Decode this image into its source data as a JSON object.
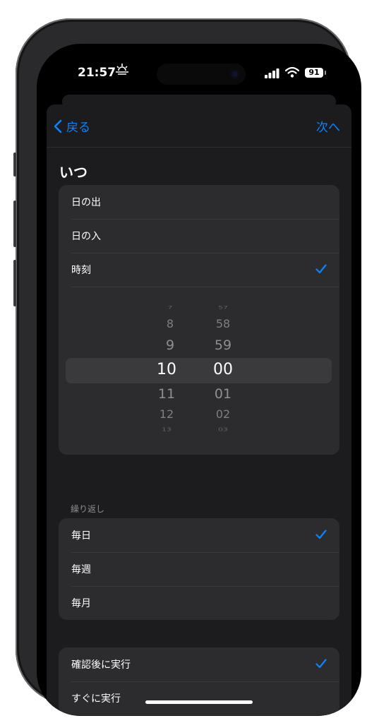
{
  "status_bar": {
    "time": "21:57",
    "battery": "91"
  },
  "nav": {
    "back_label": "戻る",
    "next_label": "次へ"
  },
  "heading": "いつ",
  "when_options": [
    {
      "label": "日の出",
      "checked": false
    },
    {
      "label": "日の入",
      "checked": false
    },
    {
      "label": "時刻",
      "checked": true
    }
  ],
  "time_picker": {
    "hours": [
      "7",
      "8",
      "9",
      "10",
      "11",
      "12",
      "13"
    ],
    "minutes": [
      "57",
      "58",
      "59",
      "00",
      "01",
      "02",
      "03"
    ],
    "selected_hour": "10",
    "selected_minute": "00"
  },
  "repeat_section": {
    "label": "繰り返し",
    "options": [
      {
        "label": "毎日",
        "checked": true
      },
      {
        "label": "毎週",
        "checked": false
      },
      {
        "label": "毎月",
        "checked": false
      }
    ]
  },
  "run_options": [
    {
      "label": "確認後に実行",
      "checked": true
    },
    {
      "label": "すぐに実行",
      "checked": false
    }
  ],
  "colors": {
    "accent": "#0a84ff",
    "background": "#1c1c1e",
    "cell": "#2c2c2e"
  }
}
